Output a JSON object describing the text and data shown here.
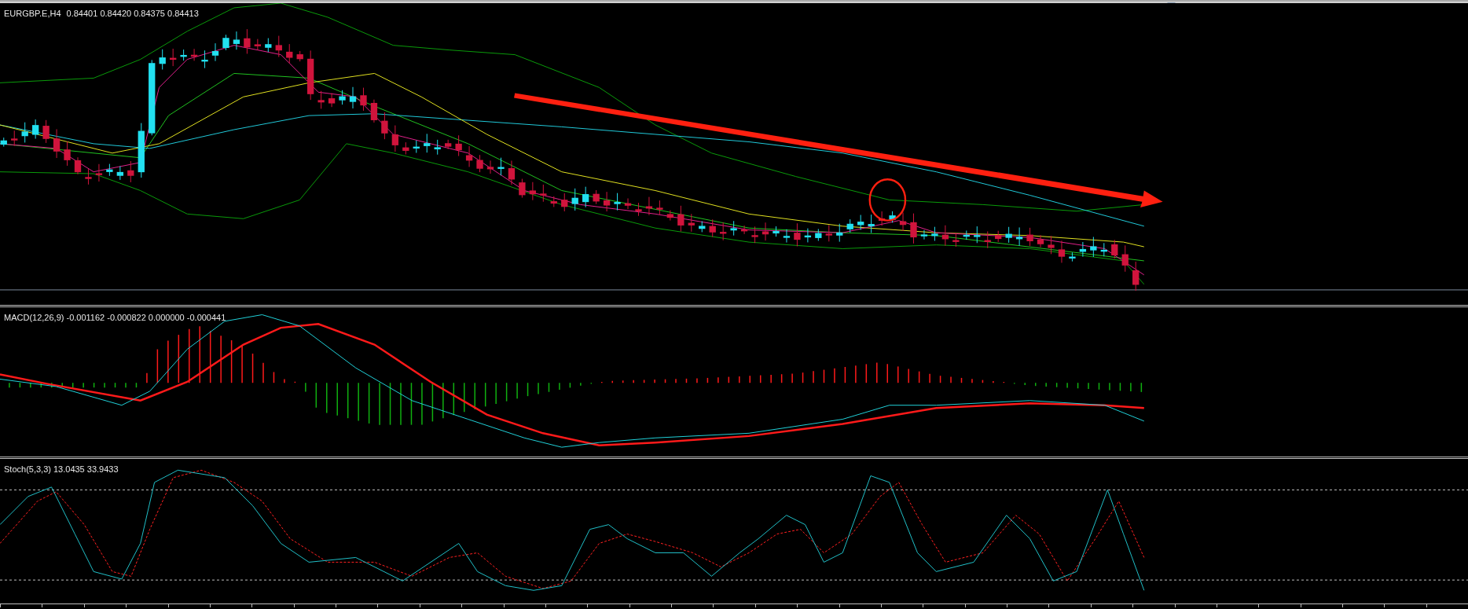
{
  "price_panel": {
    "title": "EURGBP.E,H4",
    "ohlc": "0.84401 0.84420 0.84375 0.84413"
  },
  "macd_panel": {
    "label": "MACD(12,26,9) -0.001162 -0.000822 0.000000 -0.000441"
  },
  "stochastic_panel": {
    "label": "Stoch(5,3,3) 13.0435 33.9433"
  }
}
